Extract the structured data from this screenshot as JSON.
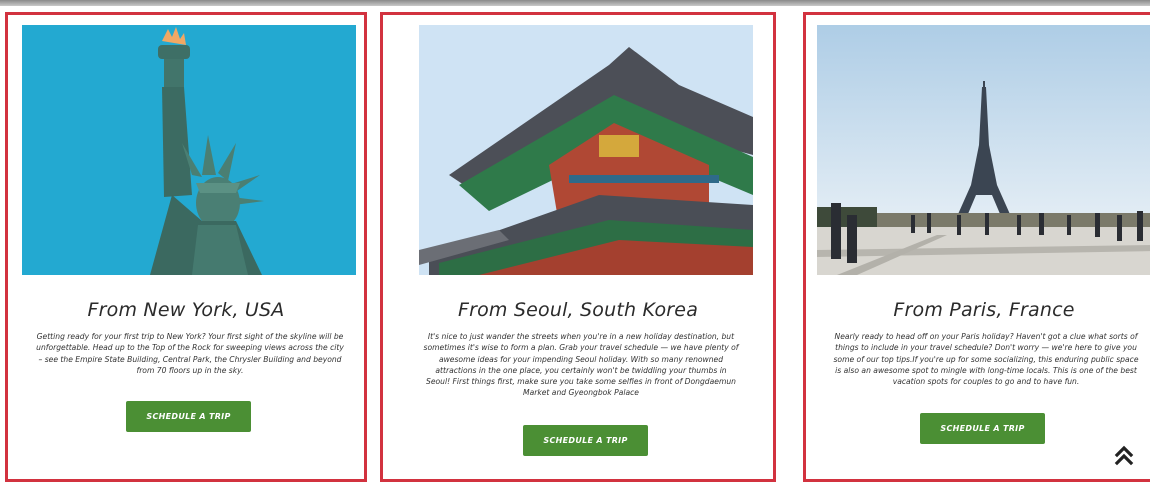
{
  "cards": [
    {
      "title": "From New York, USA",
      "description": "Getting ready for your first trip to New York? Your first sight of the skyline will be unforgettable. Head up to the Top of the Rock for sweeping views across the city – see the Empire State Building, Central Park, the Chrysler Building and beyond from 70 floors up in the sky.",
      "button": "SCHEDULE A TRIP",
      "image": "statue-of-liberty"
    },
    {
      "title": "From Seoul, South Korea",
      "description": "It's nice to just wander the streets when you're in a new holiday destination, but sometimes it's wise to form a plan. Grab your travel schedule — we have plenty of awesome ideas for your impending Seoul holiday. With so many renowned attractions in the one place, you certainly won't be twiddling your thumbs in Seoul! First things first, make sure you take some selfies in front of Dongdaemun Market and Gyeongbok Palace",
      "button": "SCHEDULE A TRIP",
      "image": "gyeongbok-palace"
    },
    {
      "title": "From Paris, France",
      "description": "Nearly ready to head off on your Paris holiday? Haven't got a clue what sorts of things to include in your travel schedule? Don't worry — we're here to give you some of our top tips.If you're up for some socializing, this enduring public space is also an awesome spot to mingle with long-time locals. This is one of the best vacation spots for couples to go and to have fun.",
      "button": "SCHEDULE A TRIP",
      "image": "eiffel-tower"
    }
  ],
  "scroll_top_icon": "double-chevron-up-icon",
  "colors": {
    "card_border": "#d2323f",
    "button": "#4b8f34"
  }
}
